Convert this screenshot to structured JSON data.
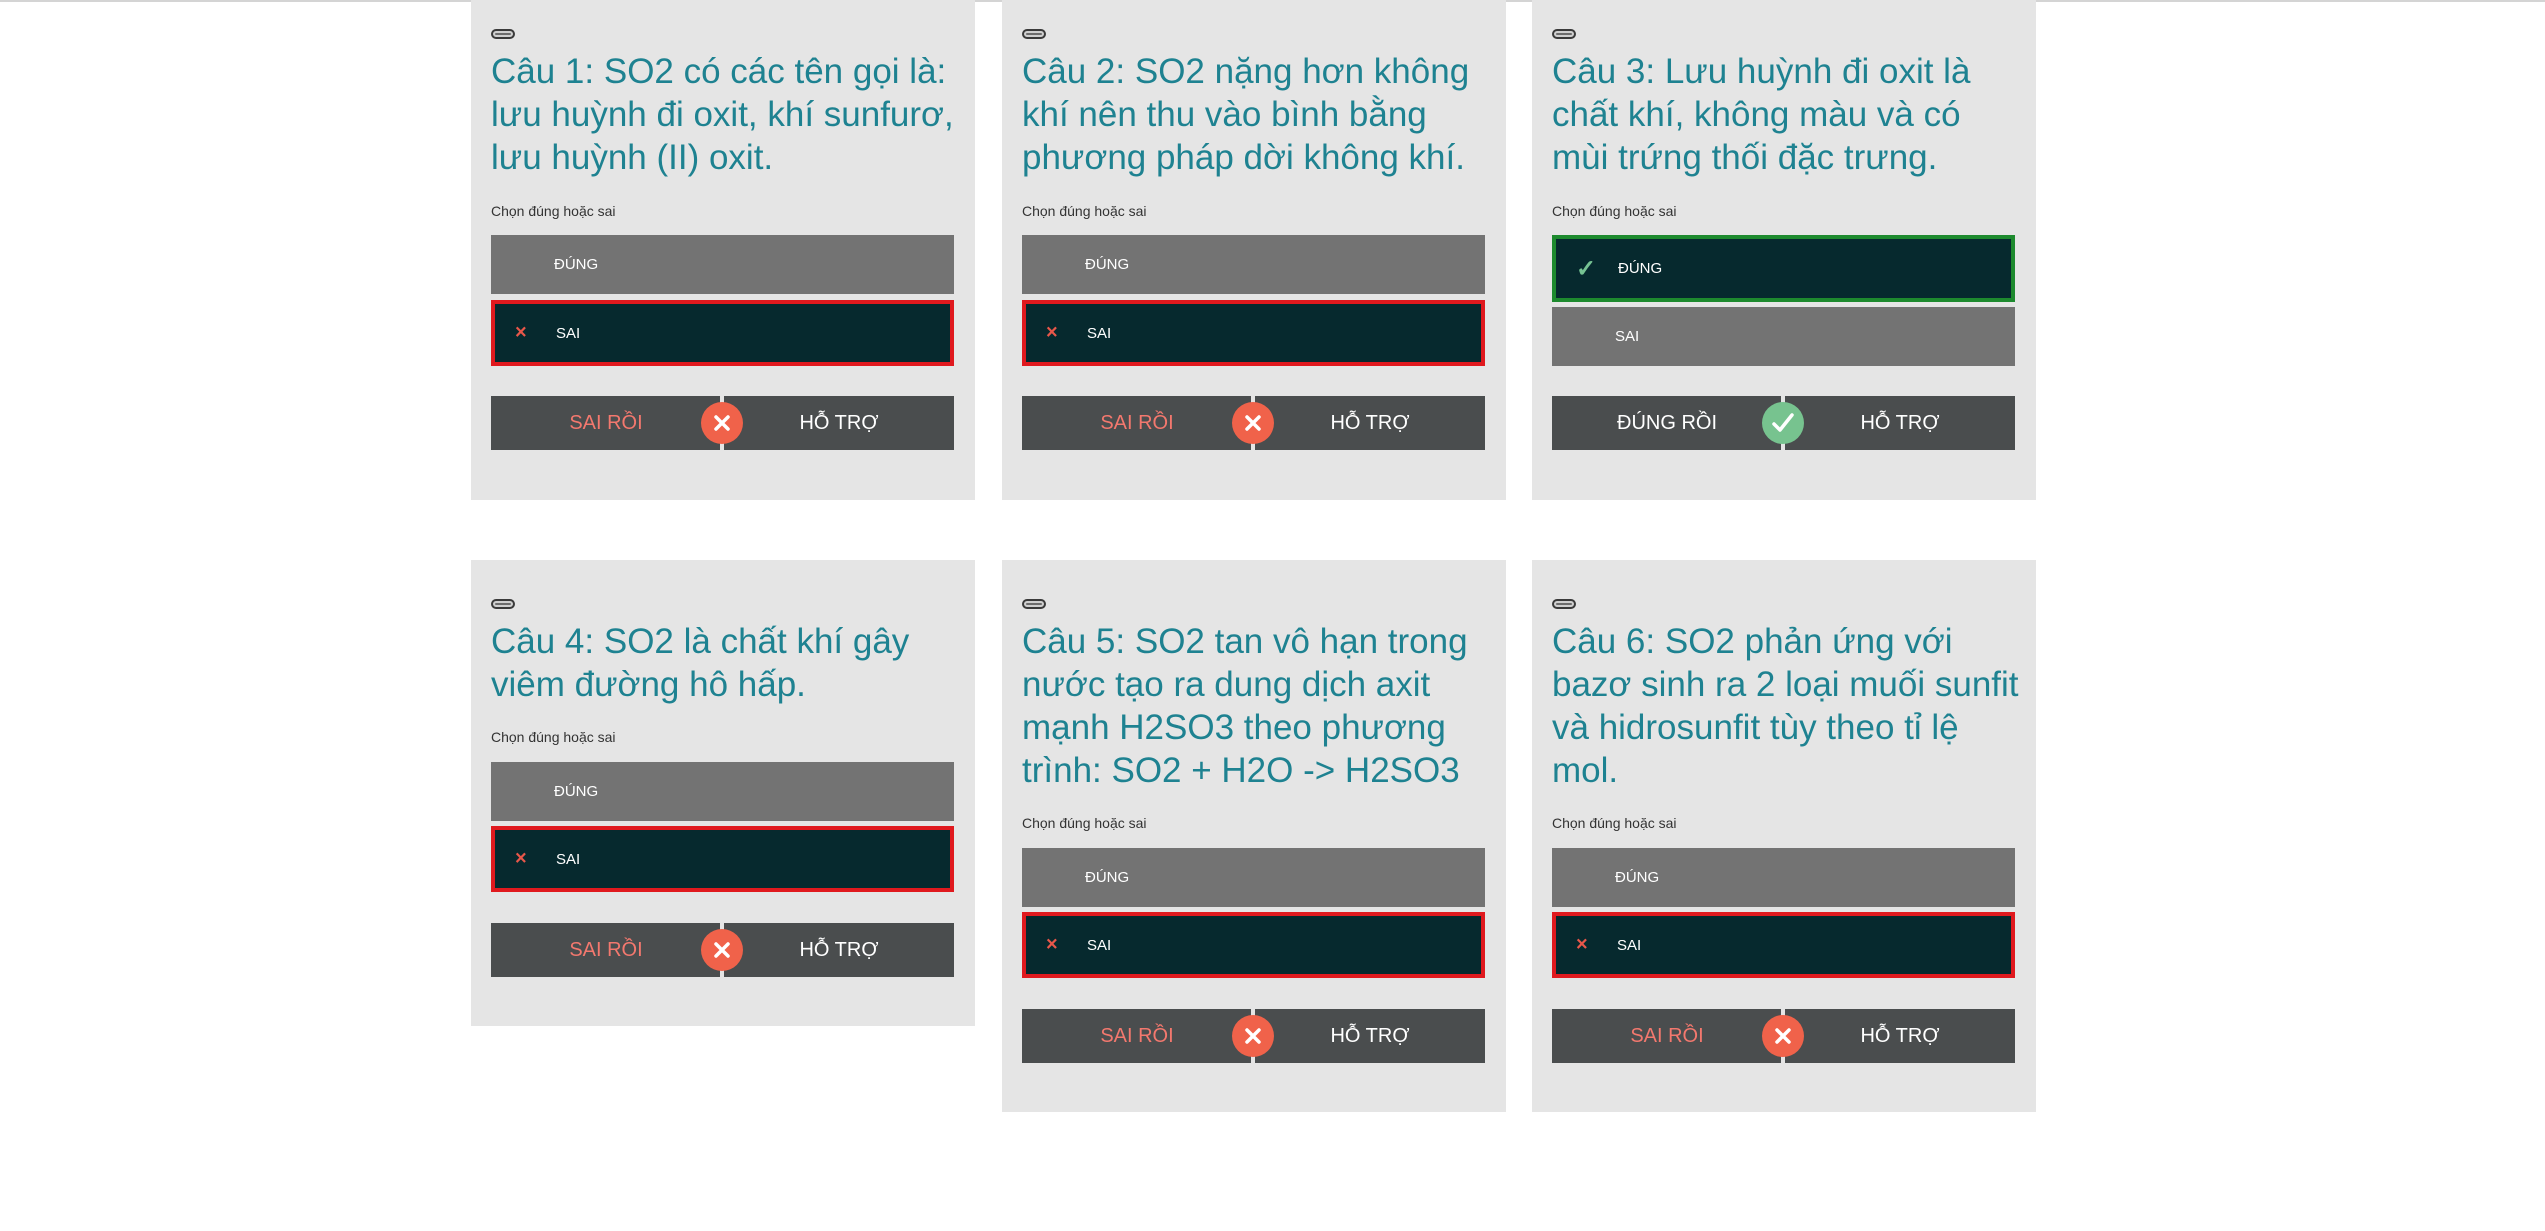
{
  "cards": [
    {
      "question": "Câu 1: SO2 có các tên gọi là: lưu huỳnh đi oxit, khí sunfurơ, lưu huỳnh (II) oxit.",
      "instruction": "Chọn đúng hoặc sai",
      "option_true": "ĐÚNG",
      "option_false": "SAI",
      "status": "SAI RỒI",
      "help": "HỖ TRỢ"
    },
    {
      "question": "Câu 2: SO2 nặng hơn không khí nên thu vào bình bằng phương pháp dời không khí.",
      "instruction": "Chọn đúng hoặc sai",
      "option_true": "ĐÚNG",
      "option_false": "SAI",
      "status": "SAI RỒI",
      "help": "HỖ TRỢ"
    },
    {
      "question": "Câu 3: Lưu huỳnh đi oxit là chất khí, không màu và có mùi trứng thối đặc trưng.",
      "instruction": "Chọn đúng hoặc sai",
      "option_true": "ĐÚNG",
      "option_false": "SAI",
      "status": "ĐÚNG RỒI",
      "help": "HỖ TRỢ"
    },
    {
      "question": "Câu 4: SO2 là chất khí gây viêm đường hô hấp.",
      "instruction": "Chọn đúng hoặc sai",
      "option_true": "ĐÚNG",
      "option_false": "SAI",
      "status": "SAI RỒI",
      "help": "HỖ TRỢ"
    },
    {
      "question": "Câu 5: SO2 tan vô hạn trong nước tạo ra dung dịch axit mạnh H2SO3 theo phương trình: SO2 + H2O -> H2SO3",
      "instruction": "Chọn đúng hoặc sai",
      "option_true": "ĐÚNG",
      "option_false": "SAI",
      "status": "SAI RỒI",
      "help": "HỖ TRỢ"
    },
    {
      "question": "Câu 6: SO2 phản ứng với bazơ sinh ra 2 loại muối sunfit và hidrosunfit tùy theo tỉ lệ mol.",
      "instruction": "Chọn đúng hoặc sai",
      "option_true": "ĐÚNG",
      "option_false": "SAI",
      "status": "SAI RỒI",
      "help": "HỖ TRỢ"
    }
  ],
  "icons": {
    "wrong_mark": "×",
    "right_mark": "✓",
    "wrong_badge": "close-circle-icon",
    "right_badge": "check-circle-icon",
    "slot": "pill-icon"
  },
  "colors": {
    "question": "#1e8291",
    "wrong_border": "#e0191e",
    "right_border": "#1d8a2e",
    "selected_bg": "#06292e",
    "wrong_status": "#f3786e"
  }
}
